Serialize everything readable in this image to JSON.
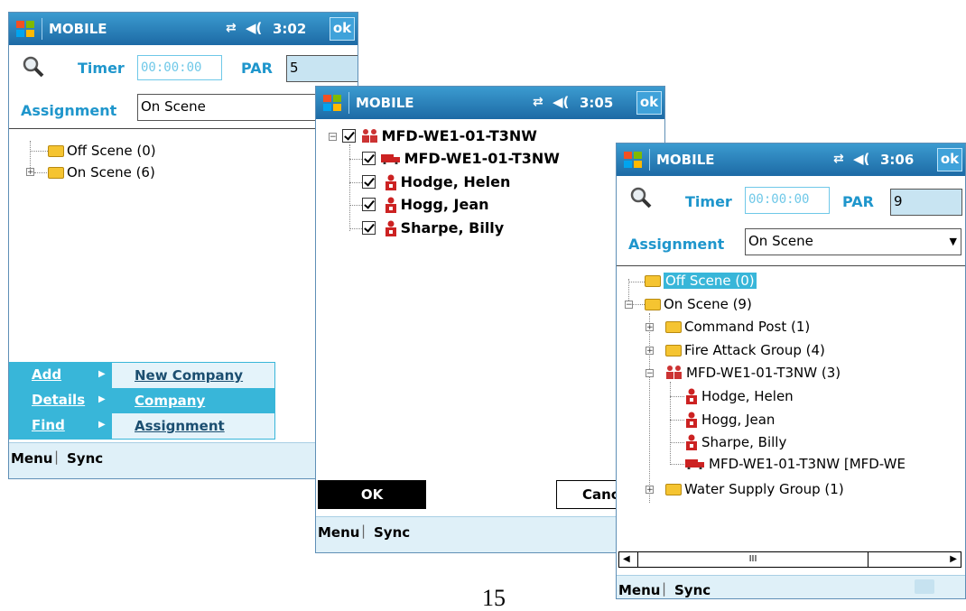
{
  "status": {
    "title": "MOBILE",
    "ok_label": "ok"
  },
  "colors": {
    "accent": "#38b6d9",
    "titlebar": "#1d6aa5",
    "label": "#1f96cc"
  },
  "screen1": {
    "time": "3:02",
    "timer_label": "Timer",
    "timer_value": "00:00:00",
    "par_label": "PAR",
    "par_value": "5",
    "assignment_label": "Assignment",
    "assignment_value": "On Scene",
    "tree": [
      "Off Scene (0)",
      "On Scene (6)"
    ],
    "popup_left": [
      "Add",
      "Details",
      "Find"
    ],
    "popup_right": [
      "New Company",
      "Company",
      "Assignment"
    ],
    "menu_left": "Menu",
    "menu_right": "Sync"
  },
  "screen2": {
    "time": "3:05",
    "root": "MFD-WE1-01-T3NW",
    "children": [
      "MFD-WE1-01-T3NW",
      "Hodge, Helen",
      "Hogg, Jean",
      "Sharpe, Billy"
    ],
    "ok_button": "OK",
    "cancel_button": "Canc",
    "menu_left": "Menu",
    "menu_right": "Sync"
  },
  "screen3": {
    "time": "3:06",
    "timer_label": "Timer",
    "timer_value": "00:00:00",
    "par_label": "PAR",
    "par_value": "9",
    "assignment_label": "Assignment",
    "assignment_value": "On Scene",
    "tree": {
      "off_scene": "Off Scene (0)",
      "on_scene": "On Scene (9)",
      "command_post": "Command Post (1)",
      "fire_attack": "Fire Attack Group (4)",
      "company": "MFD-WE1-01-T3NW (3)",
      "people": [
        "Hodge, Helen",
        "Hogg, Jean",
        "Sharpe, Billy"
      ],
      "truck": "MFD-WE1-01-T3NW [MFD-WE",
      "water_supply": "Water Supply Group (1)"
    },
    "scroll_thumb": "III",
    "menu_left": "Menu",
    "menu_right": "Sync"
  },
  "page_number": "15"
}
